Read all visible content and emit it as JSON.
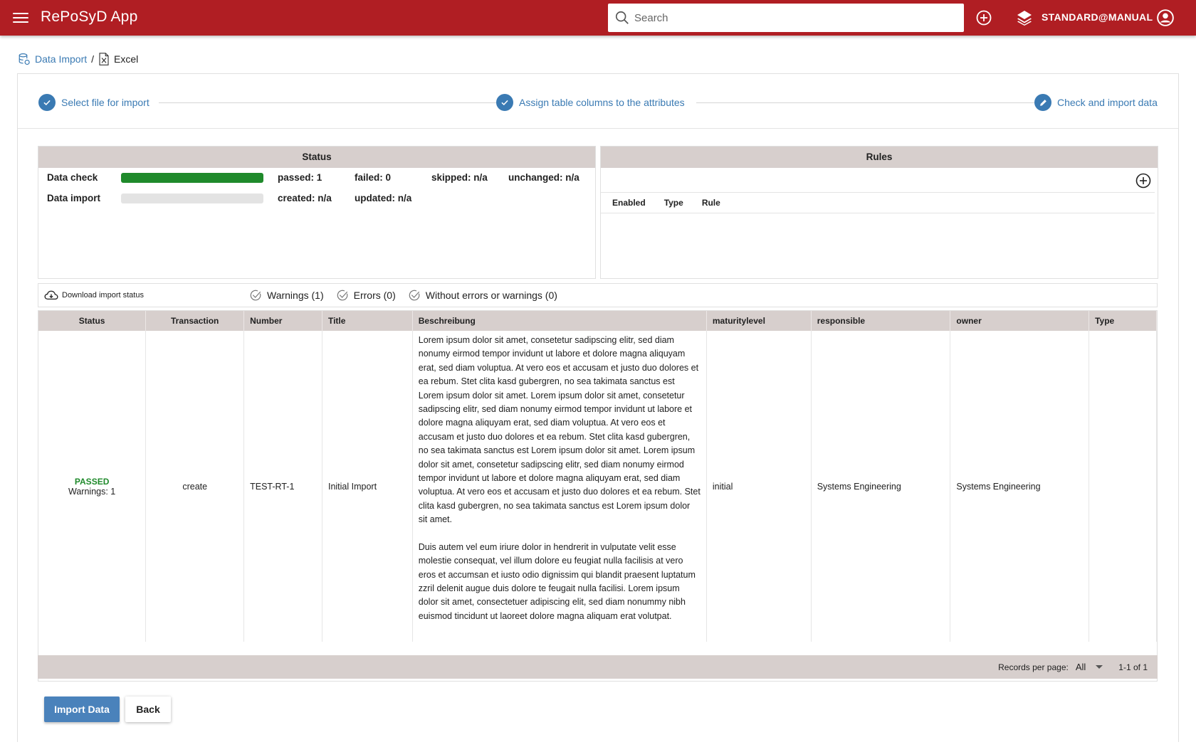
{
  "app": {
    "title": "RePoSyD App",
    "search_placeholder": "Search",
    "user": "STANDARD@MANUAL",
    "accent": "#b01e23"
  },
  "breadcrumb": {
    "parent": "Data Import",
    "separator": "/",
    "current": "Excel"
  },
  "stepper": {
    "steps": [
      {
        "label": "Select file for import",
        "icon": "check-icon"
      },
      {
        "label": "Assign table columns to the attributes",
        "icon": "check-icon"
      },
      {
        "label": "Check and import data",
        "icon": "pencil-icon"
      }
    ]
  },
  "status_panel": {
    "title": "Status",
    "data_check": {
      "label": "Data check",
      "progress": 1.0,
      "passed": "passed: 1",
      "failed": "failed: 0",
      "skipped": "skipped: n/a",
      "unchanged": "unchanged: n/a"
    },
    "data_import": {
      "label": "Data import",
      "progress": 0.0,
      "created": "created: n/a",
      "updated": "updated: n/a"
    }
  },
  "rules_panel": {
    "title": "Rules",
    "columns": [
      "Enabled",
      "Type",
      "Rule"
    ]
  },
  "filters": {
    "download": "Download import status",
    "warnings": "Warnings (1)",
    "errors": "Errors (0)",
    "without": "Without errors or warnings (0)"
  },
  "table": {
    "columns": [
      "Status",
      "Transaction",
      "Number",
      "Title",
      "Beschreibung",
      "maturitylevel",
      "responsible",
      "owner",
      "Type"
    ],
    "rows": [
      {
        "status": "PASSED",
        "warnings": "Warnings: 1",
        "transaction": "create",
        "number": "TEST-RT-1",
        "title": "Initial Import",
        "desc_p1": "Lorem ipsum dolor sit amet, consetetur sadipscing elitr, sed diam nonumy eirmod tempor invidunt ut labore et dolore magna aliquyam erat, sed diam voluptua. At vero eos et accusam et justo duo dolores et ea rebum. Stet clita kasd gubergren, no sea takimata sanctus est Lorem ipsum dolor sit amet. Lorem ipsum dolor sit amet, consetetur sadipscing elitr, sed diam nonumy eirmod tempor invidunt ut labore et dolore magna aliquyam erat, sed diam voluptua. At vero eos et accusam et justo duo dolores et ea rebum. Stet clita kasd gubergren, no sea takimata sanctus est Lorem ipsum dolor sit amet. Lorem ipsum dolor sit amet, consetetur sadipscing elitr, sed diam nonumy eirmod tempor invidunt ut labore et dolore magna aliquyam erat, sed diam voluptua. At vero eos et accusam et justo duo dolores et ea rebum. Stet clita kasd gubergren, no sea takimata sanctus est Lorem ipsum dolor sit amet.",
        "desc_p2": "Duis autem vel eum iriure dolor in hendrerit in vulputate velit esse molestie consequat, vel illum dolore eu feugiat nulla facilisis at vero eros et accumsan et iusto odio dignissim qui blandit praesent luptatum zzril delenit augue duis dolore te feugait nulla facilisi. Lorem ipsum dolor sit amet, consectetuer adipiscing elit, sed diam nonummy nibh euismod tincidunt ut laoreet dolore magna aliquam erat volutpat.",
        "maturitylevel": "initial",
        "responsible": "Systems Engineering",
        "owner": "Systems Engineering",
        "type": ""
      }
    ],
    "footer": {
      "records_per_page_label": "Records per page:",
      "records_per_page": "All",
      "page_info": "1-1 of 1"
    }
  },
  "actions": {
    "import": "Import Data",
    "back": "Back"
  }
}
